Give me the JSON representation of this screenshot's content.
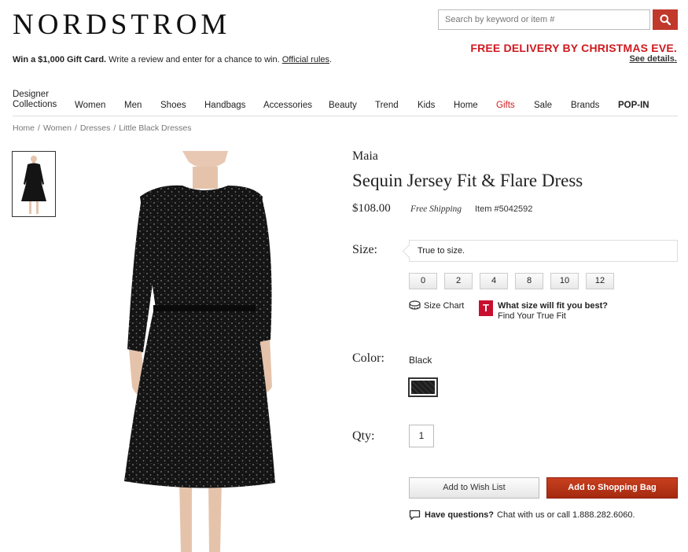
{
  "header": {
    "logo": "NORDSTROM",
    "search_placeholder": "Search by keyword or item #",
    "promo_bold": "Win a $1,000 Gift Card.",
    "promo_text": " Write a review and enter for a chance to win. ",
    "promo_link": "Official rules",
    "promo_end": ".",
    "delivery_title": "FREE DELIVERY BY CHRISTMAS EVE.",
    "delivery_link": "See details."
  },
  "nav": {
    "items": [
      {
        "label_line1": "Designer",
        "label_line2": "Collections"
      },
      {
        "label": "Women"
      },
      {
        "label": "Men"
      },
      {
        "label": "Shoes"
      },
      {
        "label": "Handbags"
      },
      {
        "label": "Accessories"
      },
      {
        "label": "Beauty"
      },
      {
        "label": "Trend"
      },
      {
        "label": "Kids"
      },
      {
        "label": "Home"
      },
      {
        "label": "Gifts"
      },
      {
        "label": "Sale"
      },
      {
        "label": "Brands"
      },
      {
        "label": "POP-IN"
      }
    ]
  },
  "breadcrumb": [
    "Home",
    "Women",
    "Dresses",
    "Little Black Dresses"
  ],
  "breadcrumb_sep": "/",
  "product": {
    "brand": "Maia",
    "title": "Sequin Jersey Fit & Flare Dress",
    "price": "$108.00",
    "shipping": "Free Shipping",
    "item_number": "Item #5042592",
    "size_label": "Size:",
    "fit_note": "True to size.",
    "sizes": [
      "0",
      "2",
      "4",
      "8",
      "10",
      "12"
    ],
    "size_chart": "Size Chart",
    "truefit_logo": "T",
    "truefit_question": "What size will fit you best?",
    "truefit_link": "Find Your True Fit",
    "color_label": "Color:",
    "color_name": "Black",
    "qty_label": "Qty:",
    "qty_value": "1",
    "wish_button": "Add to Wish List",
    "bag_button": "Add to Shopping Bag",
    "questions_bold": "Have questions?",
    "questions_text": "Chat with us or call 1.888.282.6060."
  },
  "colors": {
    "brand_red": "#d0191f",
    "bag_button": "#b5351a",
    "search_button": "#c0392b"
  }
}
